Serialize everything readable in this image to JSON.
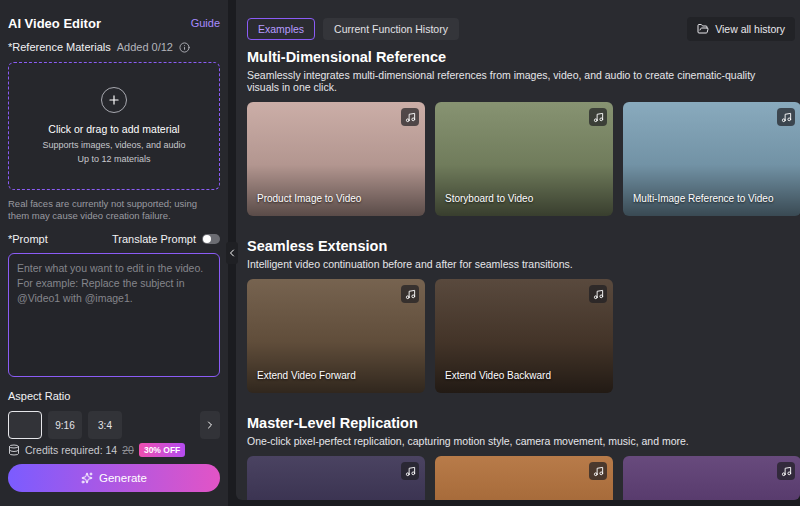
{
  "sidebar": {
    "title": "AI Video Editor",
    "guide": "Guide",
    "reference": {
      "label": "*Reference Materials",
      "count": "Added 0/12"
    },
    "dropzone": {
      "title": "Click or drag to add material",
      "lines": [
        "Supports images, videos, and audio",
        "Up to 12 materials"
      ]
    },
    "warning": "Real faces are currently not supported; using them may cause video creation failure.",
    "prompt": {
      "label": "*Prompt",
      "translate": {
        "label": "Translate Prompt",
        "on": false
      },
      "placeholder": "Enter what you want to edit in the video. For example: Replace the subject in @Video1 with @image1."
    },
    "aspect_ratio": {
      "label": "Aspect Ratio",
      "options": [
        {
          "label": "",
          "selected": true
        },
        {
          "label": "9:16",
          "selected": false
        },
        {
          "label": "3:4",
          "selected": false
        }
      ]
    },
    "credits": {
      "label": "Credits required: 14",
      "original": "20",
      "discount": "30% OFF"
    },
    "generate": "Generate"
  },
  "main": {
    "tabs": [
      {
        "label": "Examples",
        "selected": true
      },
      {
        "label": "Current Function History",
        "selected": false
      }
    ],
    "history_button": "View all history",
    "sections": [
      {
        "title": "Multi-Dimensional Reference",
        "description": "Seamlessly integrates multi-dimensional references from images, video, and audio to create cinematic-quality visuals in one click.",
        "cards": [
          {
            "label": "Product Image to Video",
            "color": "#c7a7a0"
          },
          {
            "label": "Storyboard to Video",
            "color": "#7d8a66"
          },
          {
            "label": "Multi-Image Reference to Video",
            "color": "#7fa3b8"
          }
        ]
      },
      {
        "title": "Seamless Extension",
        "description": "Intelligent video continuation before and after for seamless transitions.",
        "cards": [
          {
            "label": "Extend Video Forward",
            "color": "#6b5641"
          },
          {
            "label": "Extend Video Backward",
            "color": "#4b3a2d"
          }
        ]
      },
      {
        "title": "Master-Level Replication",
        "description": "One-click pixel-perfect replication, capturing motion style, camera movement, music, and more.",
        "cards": [
          {
            "label": "",
            "color": "#3b3354"
          },
          {
            "label": "",
            "color": "#b2703a"
          },
          {
            "label": "",
            "color": "#5b3b72"
          }
        ]
      }
    ]
  }
}
